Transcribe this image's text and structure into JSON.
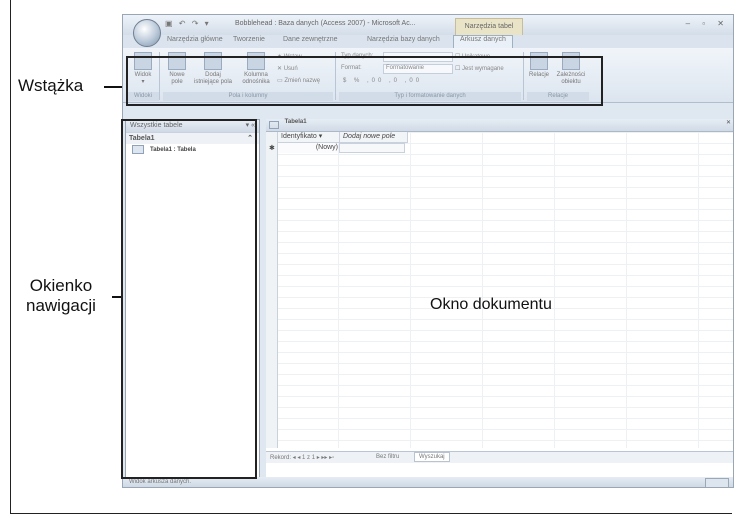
{
  "window": {
    "title": "Bobblehead : Baza danych (Access 2007) - Microsoft Ac...",
    "context_tab": "Narzędzia tabel",
    "controls": "– ▫ ✕",
    "quick_access": "▣ ↶ ↷ ▾"
  },
  "ribbon_tabs": [
    "Narzędzia główne",
    "Tworzenie",
    "Dane zewnętrzne",
    "Narzędzia bazy danych",
    "Arkusz danych"
  ],
  "ribbon": {
    "buttons": {
      "widok": "Widok",
      "nowe_pole": "Nowe pole",
      "dodaj_istniejace": "Dodaj istniejące pola",
      "kolumna_odnosnika": "Kolumna odnośnika",
      "wstaw": "Wstaw",
      "usun": "Usuń",
      "zmien_nazwe": "Zmień nazwę",
      "typ_danych": "Typ danych:",
      "format": "Format:",
      "format_value": "Formatowanie",
      "unikatowe": "Unikatowe",
      "wymagane": "Jest wymagane",
      "relacje": "Relacje",
      "zaleznosci": "Zależności obiektu"
    },
    "groups": [
      "Widoki",
      "Pola i kolumny",
      "Typ i formatowanie danych",
      "Relacje"
    ]
  },
  "nav_pane": {
    "header": "Wszystkie tabele",
    "group": "Tabela1",
    "item": "Tabela1 : Tabela"
  },
  "document": {
    "tab": "Tabela1",
    "columns": [
      "Identyfikato ▾",
      "Dodaj nowe pole"
    ],
    "new_row": "(Nowy)",
    "record_nav": "Rekord: ◂ ◂ 1 z 1 ▸ ▸▸ ▸▫",
    "filter": "Bez filtru",
    "search": "Wyszukaj"
  },
  "status_bar": "Widok arkusza danych.",
  "callouts": {
    "ribbon": "Wstążka",
    "nav_line1": "Okienko",
    "nav_line2": "nawigacji",
    "document": "Okno dokumentu"
  }
}
